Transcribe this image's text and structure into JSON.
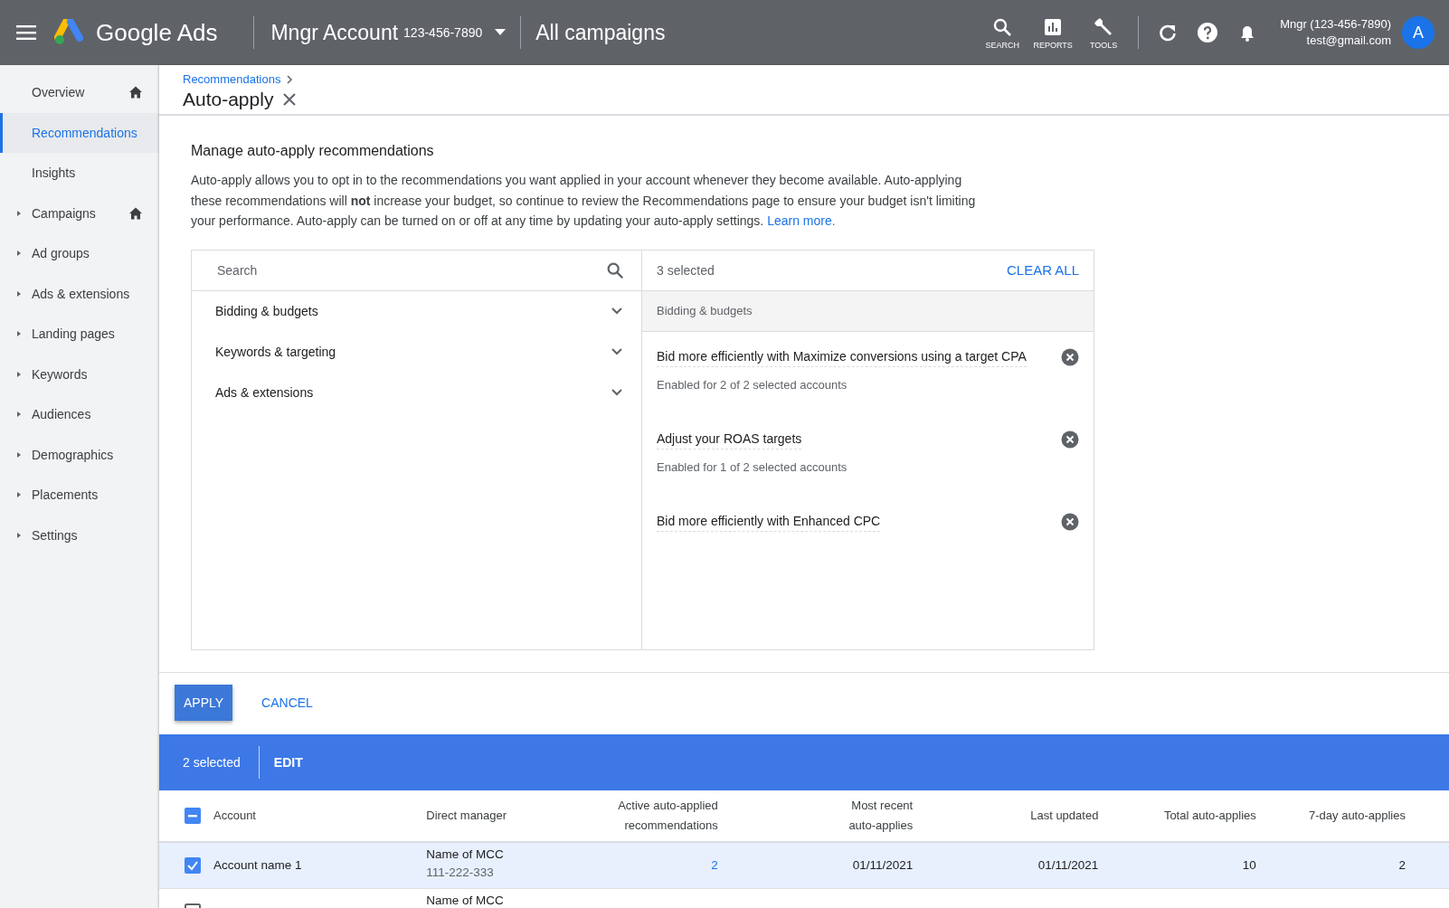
{
  "header": {
    "product": "Google Ads",
    "account_name": "Mngr Account",
    "account_id": "123-456-7890",
    "scope": "All campaigns",
    "tools": [
      {
        "kind": "search",
        "label": "SEARCH"
      },
      {
        "kind": "reports",
        "label": "REPORTS"
      },
      {
        "kind": "tools",
        "label": "TOOLS"
      }
    ],
    "user_line": "Mngr (123-456-7890)",
    "user_email": "test@gmail.com",
    "avatar": "A"
  },
  "sidebar": {
    "items": [
      {
        "label": "Overview",
        "selected": false,
        "expandable": false,
        "home": true
      },
      {
        "label": "Recommendations",
        "selected": true,
        "expandable": false,
        "home": false
      },
      {
        "label": "Insights",
        "selected": false,
        "expandable": false,
        "home": false
      },
      {
        "label": "Campaigns",
        "selected": false,
        "expandable": true,
        "home": true
      },
      {
        "label": "Ad groups",
        "selected": false,
        "expandable": true,
        "home": false
      },
      {
        "label": "Ads & extensions",
        "selected": false,
        "expandable": true,
        "home": false
      },
      {
        "label": "Landing pages",
        "selected": false,
        "expandable": true,
        "home": false
      },
      {
        "label": "Keywords",
        "selected": false,
        "expandable": true,
        "home": false
      },
      {
        "label": "Audiences",
        "selected": false,
        "expandable": true,
        "home": false
      },
      {
        "label": "Demographics",
        "selected": false,
        "expandable": true,
        "home": false
      },
      {
        "label": "Placements",
        "selected": false,
        "expandable": true,
        "home": false
      },
      {
        "label": "Settings",
        "selected": false,
        "expandable": true,
        "home": false
      }
    ]
  },
  "breadcrumb": "Recommendations",
  "page_title": "Auto-apply",
  "section_title": "Manage auto-apply recommendations",
  "description": "Auto-apply allows you to opt in to the recommendations you want applied in your account whenever they become available. Auto-applying these recommendations will **not** increase your budget, so continue to review the Recommendations page to ensure your budget isn't limiting your performance. Auto-apply can be turned on or off at any time by updating your auto-apply settings.",
  "learn_more": "Learn more.",
  "picker": {
    "search": {
      "placeholder": "Search"
    },
    "categories": [
      {
        "label": "Bidding & budgets",
        "expanded": false
      },
      {
        "label": "Keywords & targeting",
        "expanded": false
      },
      {
        "label": "Ads & extensions",
        "expanded": false
      }
    ],
    "selected_count": "3 selected",
    "clear_all": "CLEAR ALL",
    "group": "Bidding & budgets",
    "selected_items": [
      {
        "title": "Bid more efficiently with Maximize conversions using a target CPA",
        "detail": "Enabled for 2 of 2 selected accounts"
      },
      {
        "title": "Adjust your ROAS targets",
        "detail": "Enabled for 1 of 2 selected accounts"
      },
      {
        "title": "Bid more efficiently with Enhanced CPC"
      }
    ]
  },
  "actions": {
    "apply": "APPLY",
    "cancel": "CANCEL"
  },
  "selection_bar": {
    "count": "2 selected",
    "edit": "EDIT"
  },
  "table": {
    "select_all_indeterminate": true,
    "columns": [
      {
        "label": "Account"
      },
      {
        "label": "Direct manager"
      },
      {
        "label": "Active auto-applied recommendations"
      },
      {
        "label": "Most recent auto-applies"
      },
      {
        "label": "Last updated"
      },
      {
        "label": "Total auto-applies"
      },
      {
        "label": "7-day auto-applies"
      }
    ],
    "rows": [
      {
        "checked": true,
        "account": "Account name 1",
        "manager": "Name of MCC",
        "manager_id": "111-222-333",
        "active": "2",
        "recent": "01/11/2021",
        "updated": "01/11/2021",
        "total": "10",
        "week": "2"
      },
      {
        "checked": false,
        "manager": "Name of MCC"
      }
    ]
  }
}
